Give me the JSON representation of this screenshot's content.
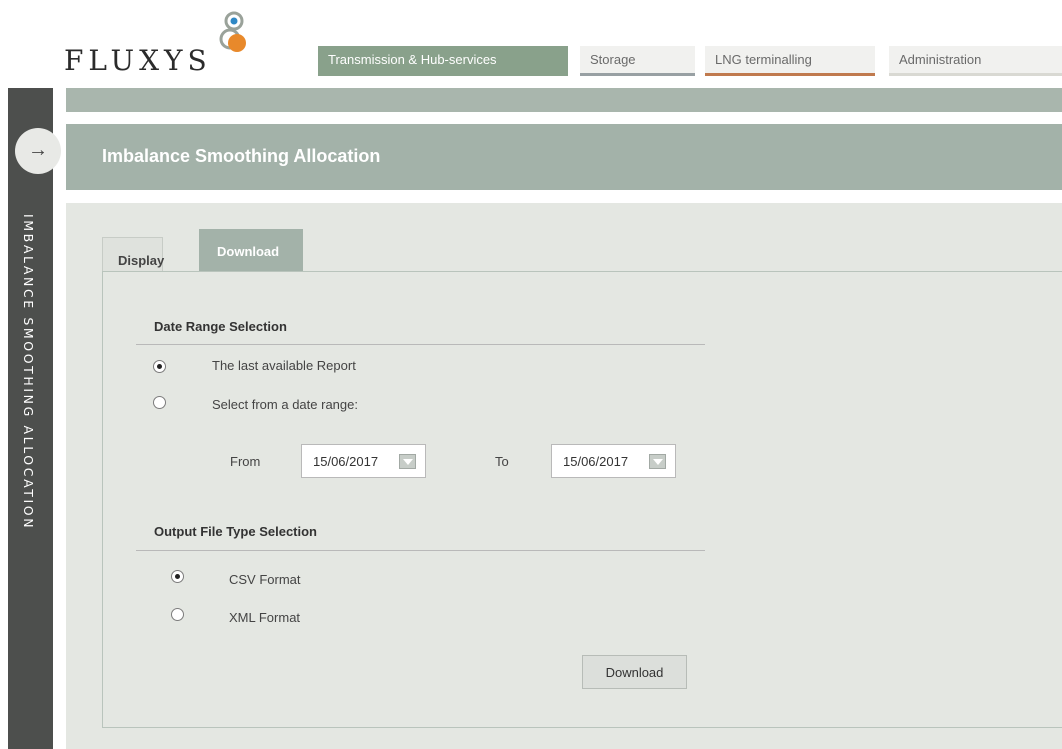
{
  "brand": {
    "logo_text": "FLUXYS",
    "colors": {
      "green": "#89a18b",
      "orange": "#e8892b",
      "blue": "#2f88c5"
    }
  },
  "nav": {
    "items": [
      {
        "label": "Transmission & Hub-services",
        "active": true
      },
      {
        "label": "Storage"
      },
      {
        "label": "LNG terminalling"
      },
      {
        "label": "Administration"
      }
    ]
  },
  "sidebar": {
    "toggle_icon": "arrow-right-icon",
    "toggle_glyph": "→",
    "title": "IMBALANCE SMOOTHING ALLOCATION"
  },
  "page": {
    "title": "Imbalance Smoothing Allocation"
  },
  "tabs": [
    {
      "label": "Display",
      "active": false
    },
    {
      "label": "Download",
      "active": true
    }
  ],
  "date_range": {
    "title": "Date Range Selection",
    "options": [
      {
        "label": "The last available Report",
        "checked": true
      },
      {
        "label": "Select from a date range:",
        "checked": false
      }
    ],
    "from_label": "From",
    "from_value": "15/06/2017",
    "to_label": "To",
    "to_value": "15/06/2017"
  },
  "output_type": {
    "title": "Output File Type Selection",
    "options": [
      {
        "label": "CSV Format",
        "checked": true
      },
      {
        "label": "XML Format",
        "checked": false
      }
    ]
  },
  "actions": {
    "download_label": "Download"
  }
}
